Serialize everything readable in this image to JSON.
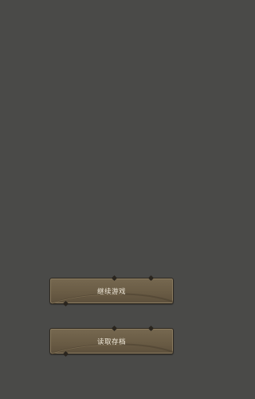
{
  "menu": {
    "continue_label": "继续游戏",
    "load_label": "读取存档"
  },
  "colors": {
    "background": "#4a4a48",
    "button_fill": "#6a5c45",
    "button_border": "#2f2a22",
    "button_text": "#f2ebdc"
  },
  "icons": [
    "ornament-gem-icon"
  ]
}
